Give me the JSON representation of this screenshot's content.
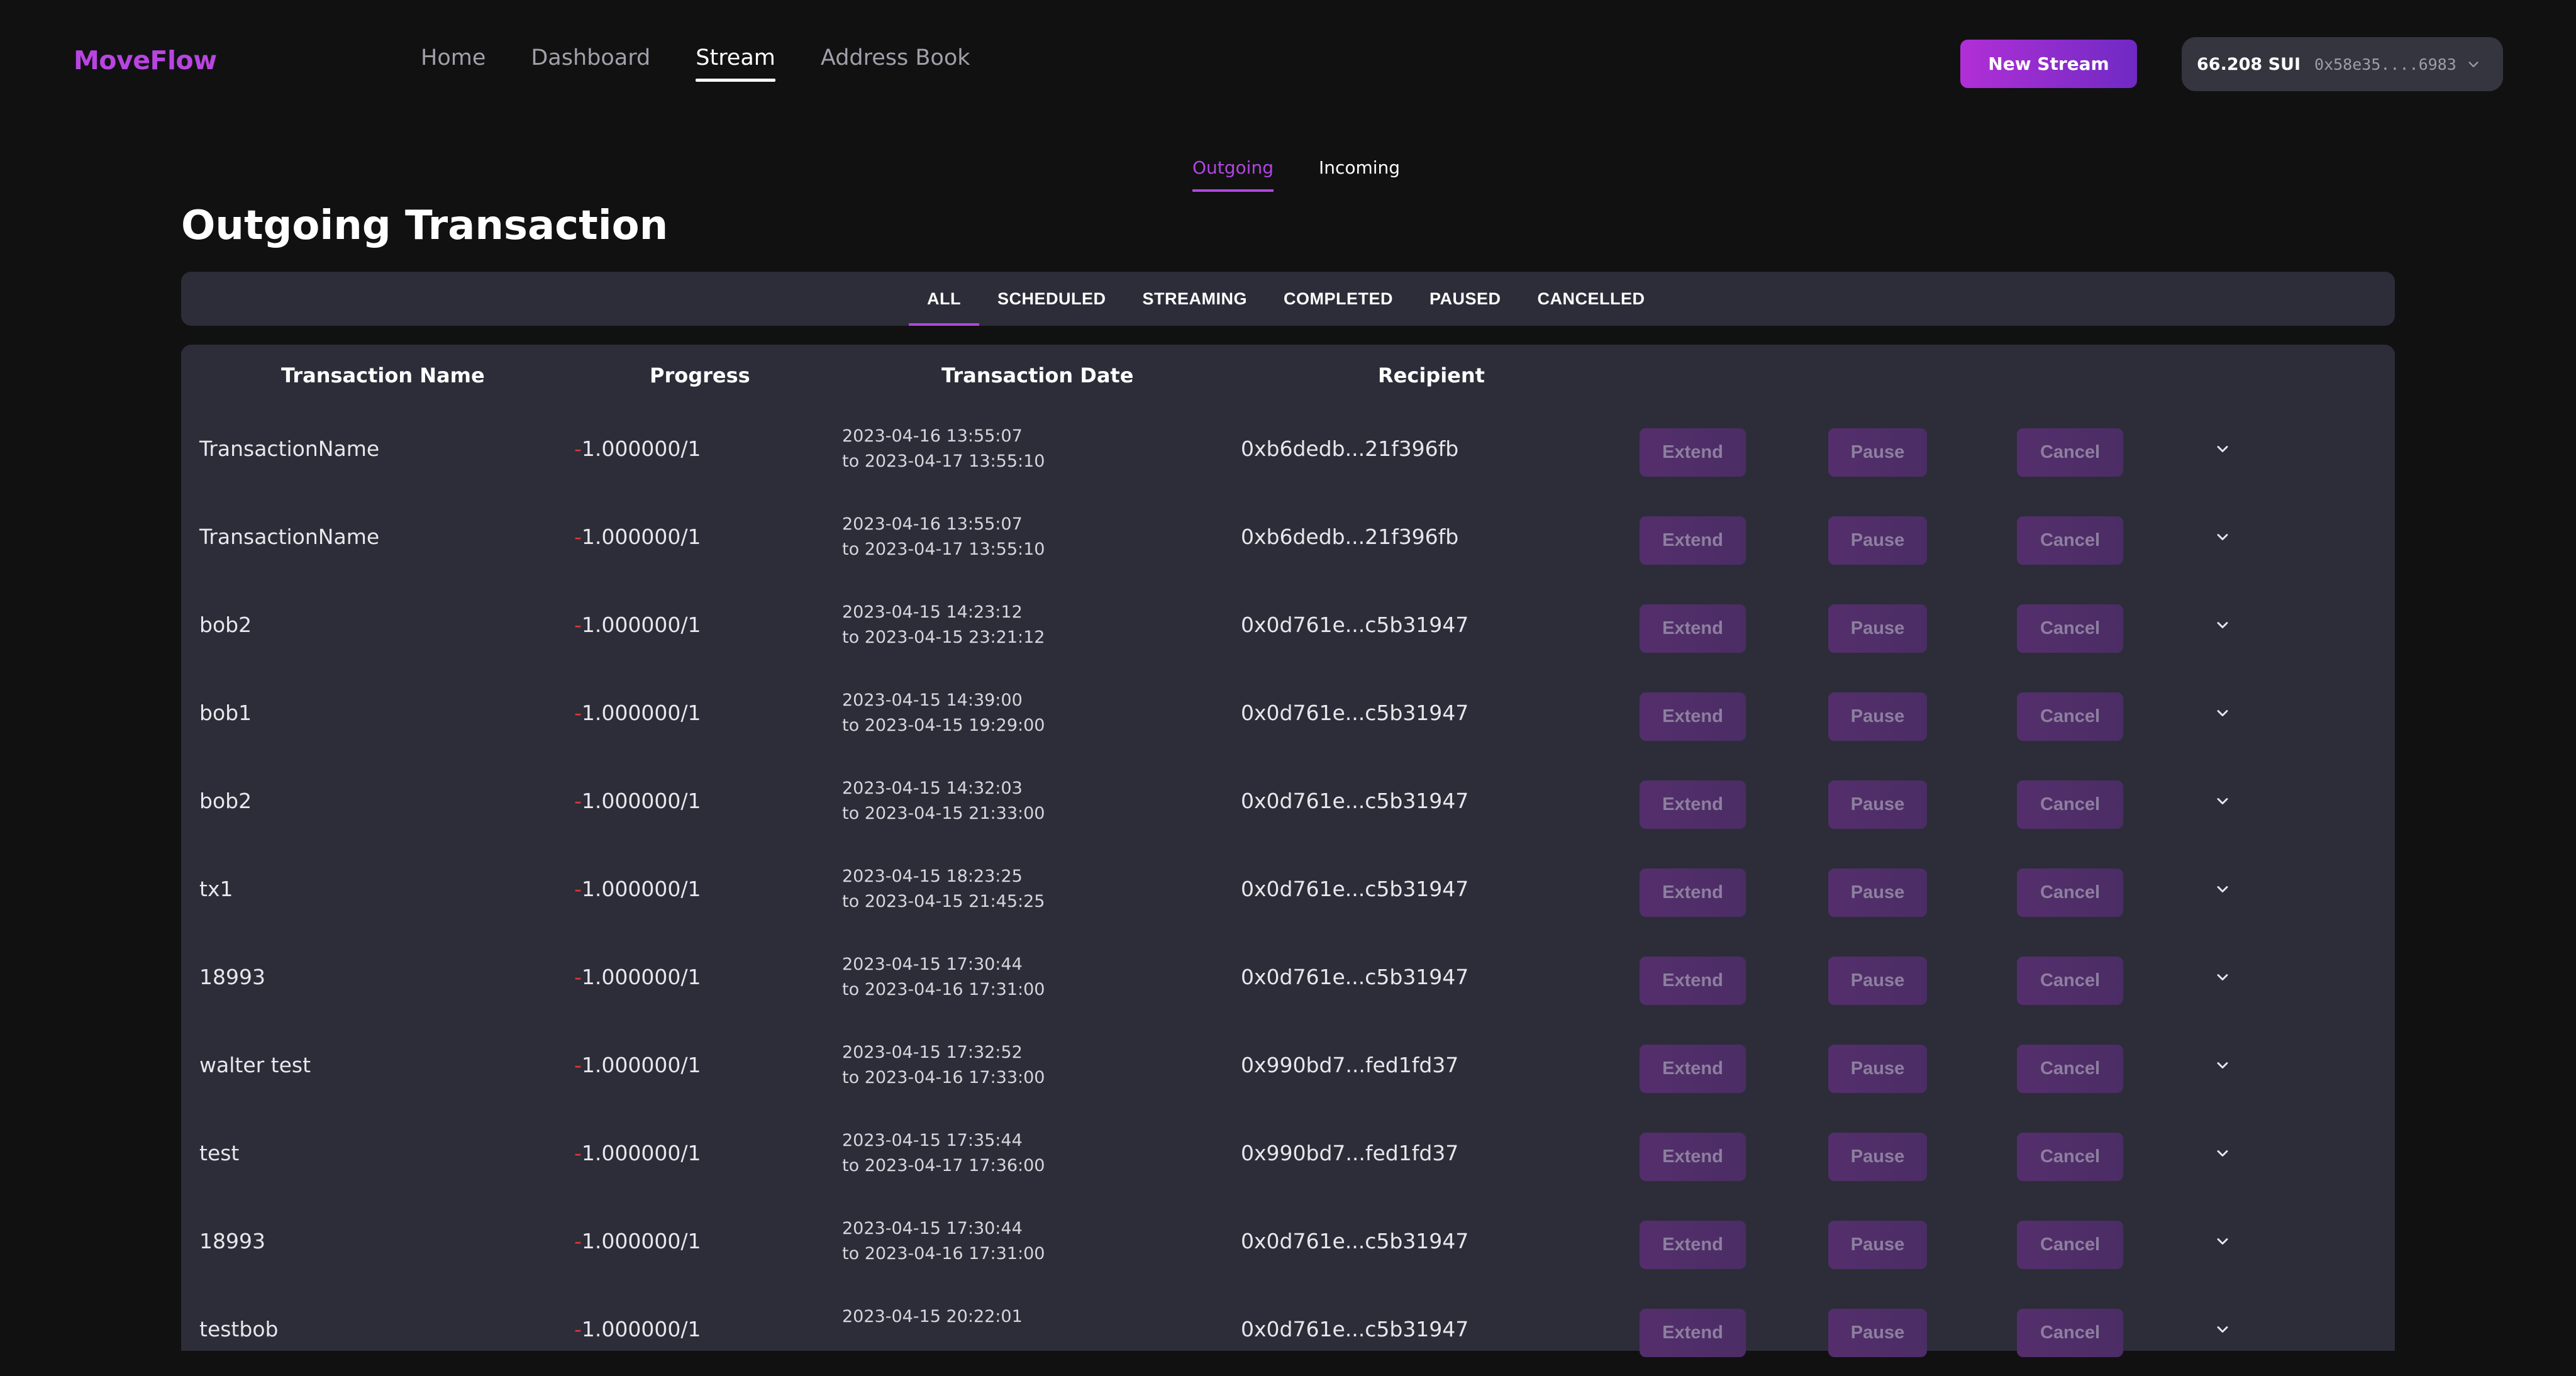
{
  "app": {
    "logo": "MoveFlow"
  },
  "nav": {
    "items": [
      {
        "label": "Home"
      },
      {
        "label": "Dashboard"
      },
      {
        "label": "Stream"
      },
      {
        "label": "Address Book"
      }
    ],
    "active": "Stream"
  },
  "header": {
    "new_stream_label": "New Stream",
    "wallet": {
      "balance": "66.208 SUI",
      "address": "0x58e35....6983"
    }
  },
  "direction_tabs": {
    "outgoing": "Outgoing",
    "incoming": "Incoming",
    "active": "Outgoing"
  },
  "page_title": "Outgoing Transaction",
  "filters": {
    "items": [
      "ALL",
      "SCHEDULED",
      "STREAMING",
      "COMPLETED",
      "PAUSED",
      "CANCELLED"
    ],
    "active": "ALL"
  },
  "table": {
    "headers": {
      "name": "Transaction Name",
      "progress": "Progress",
      "date": "Transaction Date",
      "recipient": "Recipient"
    },
    "actions": {
      "extend": "Extend",
      "pause": "Pause",
      "cancel": "Cancel"
    },
    "rows": [
      {
        "name": "TransactionName",
        "progress_sign": "-",
        "progress": "1.000000/1",
        "date_from": "2023-04-16 13:55:07",
        "date_to": "to 2023-04-17 13:55:10",
        "recipient": "0xb6dedb...21f396fb"
      },
      {
        "name": "TransactionName",
        "progress_sign": "-",
        "progress": "1.000000/1",
        "date_from": "2023-04-16 13:55:07",
        "date_to": "to 2023-04-17 13:55:10",
        "recipient": "0xb6dedb...21f396fb"
      },
      {
        "name": "bob2",
        "progress_sign": "-",
        "progress": "1.000000/1",
        "date_from": "2023-04-15 14:23:12",
        "date_to": "to 2023-04-15 23:21:12",
        "recipient": "0x0d761e...c5b31947"
      },
      {
        "name": "bob1",
        "progress_sign": "-",
        "progress": "1.000000/1",
        "date_from": "2023-04-15 14:39:00",
        "date_to": "to 2023-04-15 19:29:00",
        "recipient": "0x0d761e...c5b31947"
      },
      {
        "name": "bob2",
        "progress_sign": "-",
        "progress": "1.000000/1",
        "date_from": "2023-04-15 14:32:03",
        "date_to": "to 2023-04-15 21:33:00",
        "recipient": "0x0d761e...c5b31947"
      },
      {
        "name": "tx1",
        "progress_sign": "-",
        "progress": "1.000000/1",
        "date_from": "2023-04-15 18:23:25",
        "date_to": "to 2023-04-15 21:45:25",
        "recipient": "0x0d761e...c5b31947"
      },
      {
        "name": "18993",
        "progress_sign": "-",
        "progress": "1.000000/1",
        "date_from": "2023-04-15 17:30:44",
        "date_to": "to 2023-04-16 17:31:00",
        "recipient": "0x0d761e...c5b31947"
      },
      {
        "name": "walter test",
        "progress_sign": "-",
        "progress": "1.000000/1",
        "date_from": "2023-04-15 17:32:52",
        "date_to": "to 2023-04-16 17:33:00",
        "recipient": "0x990bd7...fed1fd37"
      },
      {
        "name": "test",
        "progress_sign": "-",
        "progress": "1.000000/1",
        "date_from": "2023-04-15 17:35:44",
        "date_to": "to 2023-04-17 17:36:00",
        "recipient": "0x990bd7...fed1fd37"
      },
      {
        "name": "18993",
        "progress_sign": "-",
        "progress": "1.000000/1",
        "date_from": "2023-04-15 17:30:44",
        "date_to": "to 2023-04-16 17:31:00",
        "recipient": "0x0d761e...c5b31947"
      },
      {
        "name": "testbob",
        "progress_sign": "-",
        "progress": "1.000000/1",
        "date_from": "2023-04-15 20:22:01",
        "date_to": "",
        "recipient": "0x0d761e...c5b31947"
      }
    ]
  },
  "colors": {
    "accent": "#b246e0",
    "negative": "#d43a3a",
    "panel": "#2c2d38",
    "background": "#111112"
  }
}
